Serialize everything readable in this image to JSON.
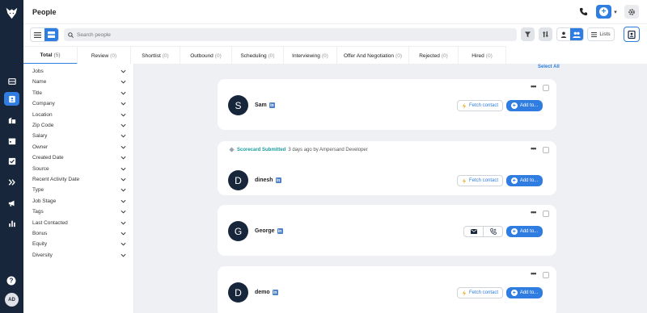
{
  "app": {
    "title": "People",
    "avatar_initials": "AD",
    "brand_color": "#2f7de1",
    "rail_color": "#17263a"
  },
  "nav": {
    "items": [
      {
        "icon": "inbox-icon"
      },
      {
        "icon": "contacts-icon",
        "active": true
      },
      {
        "icon": "building-icon"
      },
      {
        "icon": "calendar-icon"
      },
      {
        "icon": "checkbox-icon"
      },
      {
        "icon": "sequence-icon"
      },
      {
        "icon": "megaphone-icon"
      },
      {
        "icon": "bar-chart-icon"
      }
    ]
  },
  "toolbar": {
    "search_placeholder": "Search people",
    "lists_label": "Lists"
  },
  "tabs": [
    {
      "label": "Total",
      "count": "(5)",
      "active": true
    },
    {
      "label": "Review",
      "count": "(0)"
    },
    {
      "label": "Shortlist",
      "count": "(0)"
    },
    {
      "label": "Outbound",
      "count": "(0)"
    },
    {
      "label": "Scheduling",
      "count": "(0)"
    },
    {
      "label": "Interviewing",
      "count": "(0)"
    },
    {
      "label": "Offer And Negotiation",
      "count": "(0)"
    },
    {
      "label": "Rejected",
      "count": "(0)"
    },
    {
      "label": "Hired",
      "count": "(0)"
    }
  ],
  "filters": [
    "Jobs",
    "Name",
    "Title",
    "Company",
    "Location",
    "Zip Code",
    "Salary",
    "Owner",
    "Created Date",
    "Source",
    "Recent Activity Date",
    "Type",
    "Job Stage",
    "Tags",
    "Last Contacted",
    "Bonus",
    "Equity",
    "Diversity"
  ],
  "list": {
    "select_all_label": "Select All",
    "fetch_label": "Fetch contact",
    "add_to_label": "Add to...",
    "people": [
      {
        "initial": "S",
        "name": "Sam",
        "action": "fetch"
      },
      {
        "initial": "D",
        "name": "dinesh",
        "action": "fetch",
        "activity": {
          "highlight": "Scorecard Submitted",
          "rest": "3 days ago by Ampersand Developer"
        }
      },
      {
        "initial": "G",
        "name": "George",
        "action": "contact"
      },
      {
        "initial": "D",
        "name": "demo",
        "action": "fetch"
      }
    ]
  }
}
